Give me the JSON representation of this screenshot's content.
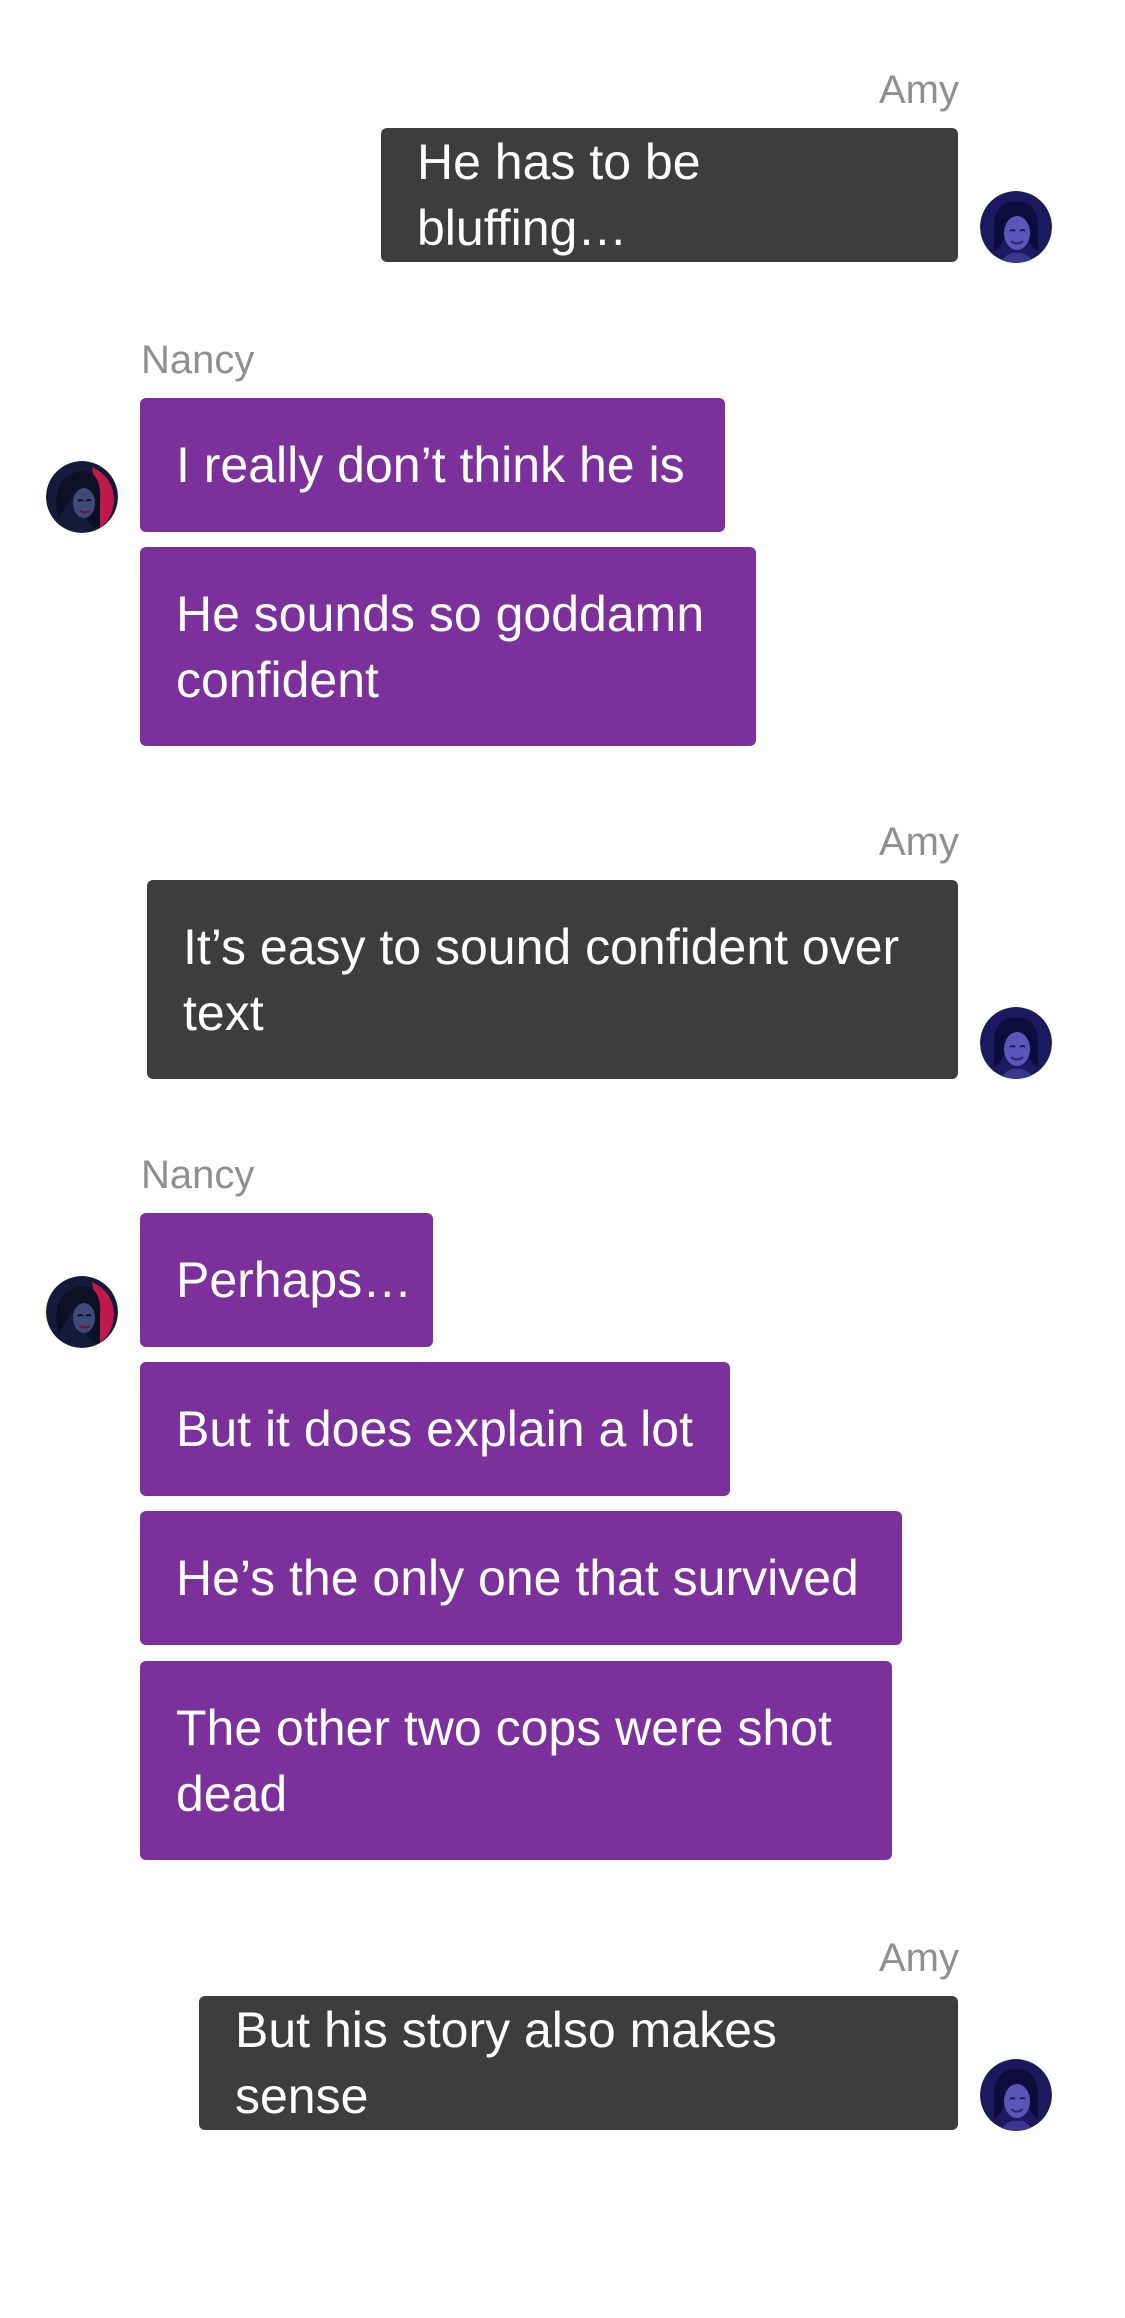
{
  "conversation": {
    "participants": {
      "amy": {
        "name": "Amy",
        "avatar_icon": "amy-avatar-icon",
        "bubble_color": "#3d3d3d"
      },
      "nancy": {
        "name": "Nancy",
        "avatar_icon": "nancy-avatar-icon",
        "bubble_color": "#7c309c"
      }
    },
    "groups": [
      {
        "sender": "Amy",
        "messages": [
          "He has to be bluffing…"
        ]
      },
      {
        "sender": "Nancy",
        "messages": [
          "I really don’t think he is",
          "He sounds so goddamn confident"
        ]
      },
      {
        "sender": "Amy",
        "messages": [
          "It’s easy to sound confident over text"
        ]
      },
      {
        "sender": "Nancy",
        "messages": [
          "Perhaps…",
          "But it does explain a lot",
          "He’s the only one that survived",
          "The other two cops were shot dead"
        ]
      },
      {
        "sender": "Amy",
        "messages": [
          "But his story also makes sense"
        ]
      }
    ]
  }
}
